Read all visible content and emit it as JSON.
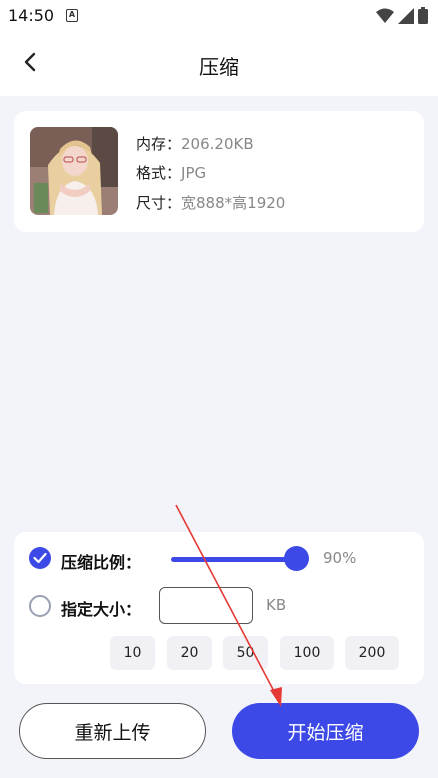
{
  "status_bar": {
    "time": "14:50",
    "sim_label": "A"
  },
  "header": {
    "title": "压缩"
  },
  "image_info": {
    "memory_label": "内存：",
    "memory_value": "206.20KB",
    "format_label": "格式：",
    "format_value": "JPG",
    "size_label": "尺寸：",
    "size_value": "宽888*高1920"
  },
  "options": {
    "ratio_label": "压缩比例：",
    "ratio_percent": "90%",
    "ratio_value": 0.9,
    "ratio_selected": true,
    "size_label": "指定大小：",
    "size_input_value": "",
    "size_unit": "KB",
    "size_selected": false,
    "presets": [
      "10",
      "20",
      "50",
      "100",
      "200"
    ]
  },
  "buttons": {
    "reupload": "重新上传",
    "start": "开始压缩"
  },
  "colors": {
    "accent": "#3d49e6",
    "annotation_arrow": "#e53935"
  }
}
